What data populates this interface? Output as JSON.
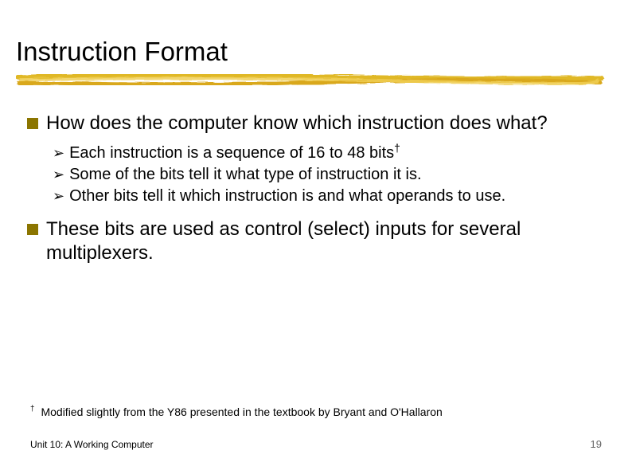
{
  "title": "Instruction Format",
  "bullets": [
    {
      "text": "How does the computer know which instruction does what?",
      "sub": [
        {
          "text": "Each instruction is a sequence of 16 to 48 bits",
          "sup": "†"
        },
        {
          "text": "Some of the bits tell it what type of instruction it is."
        },
        {
          "text": "Other bits tell it which instruction is and what operands to use."
        }
      ]
    },
    {
      "text": "These bits are used as control (select) inputs for several multiplexers.",
      "sub": []
    }
  ],
  "footnote": {
    "mark": "†",
    "text": "Modified slightly from the Y86 presented in the textbook by Bryant and O'Hallaron"
  },
  "footer": {
    "left": "Unit 10: A Working Computer",
    "right": "19"
  }
}
